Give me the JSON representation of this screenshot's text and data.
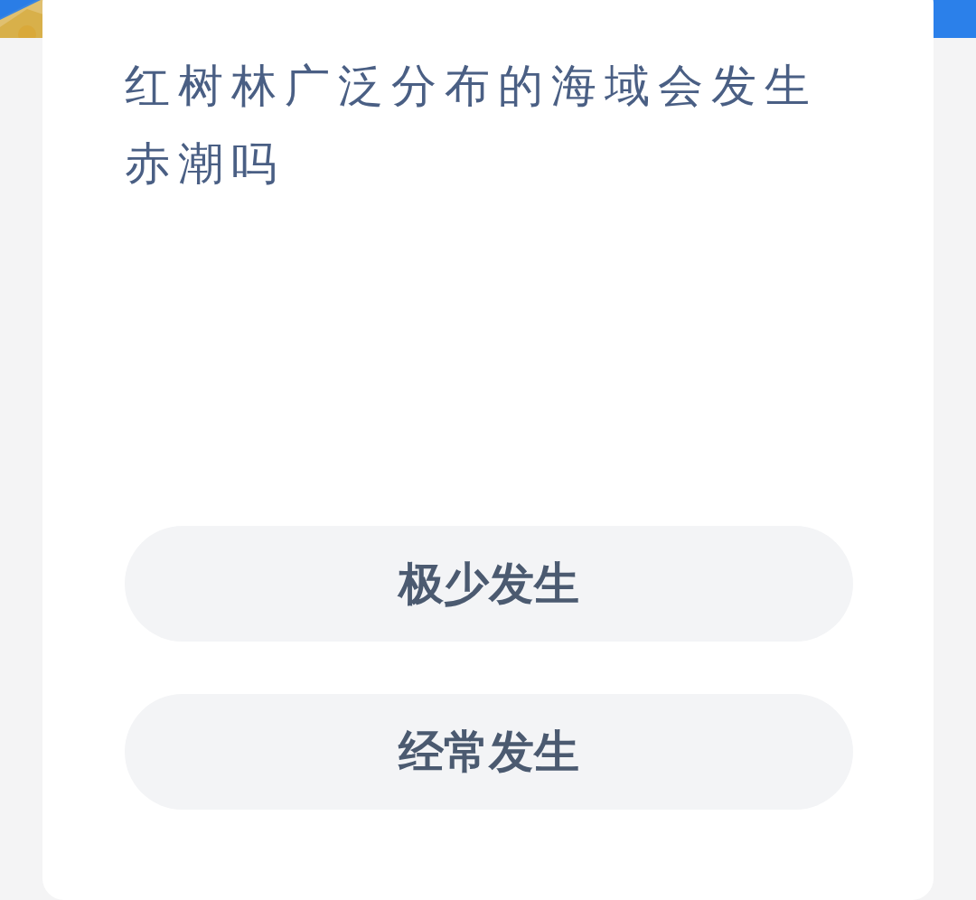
{
  "question": "红树林广泛分布的海域会发生赤潮吗",
  "options": [
    {
      "label": "极少发生"
    },
    {
      "label": "经常发生"
    }
  ]
}
